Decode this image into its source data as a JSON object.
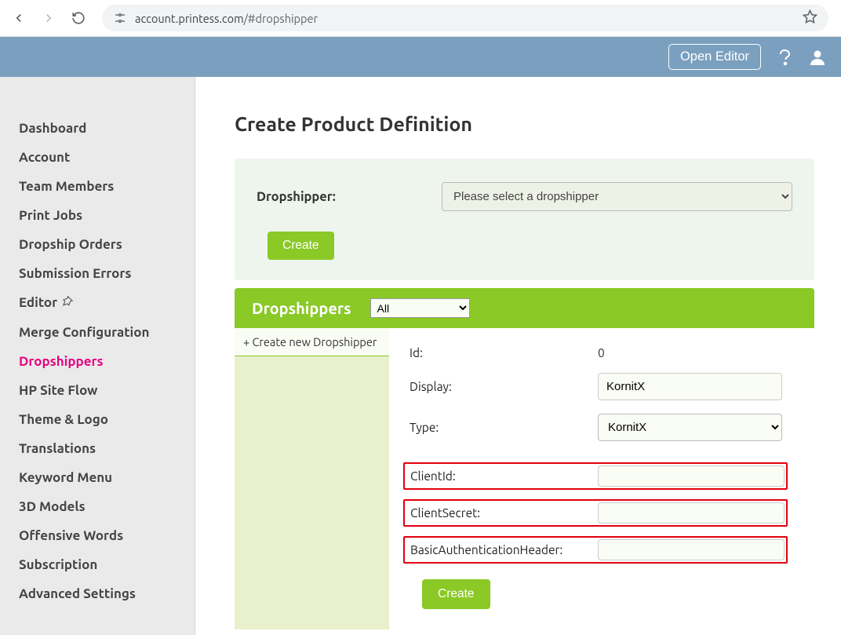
{
  "browser": {
    "url_host": "account.printess.com",
    "url_path": "/#dropshipper"
  },
  "app_bar": {
    "open_editor": "Open Editor"
  },
  "sidebar": {
    "items": [
      {
        "label": "Dashboard",
        "active": false
      },
      {
        "label": "Account",
        "active": false
      },
      {
        "label": "Team Members",
        "active": false
      },
      {
        "label": "Print Jobs",
        "active": false
      },
      {
        "label": "Dropship Orders",
        "active": false
      },
      {
        "label": "Submission Errors",
        "active": false
      },
      {
        "label": "Editor",
        "active": false,
        "icon": true
      },
      {
        "label": "Merge Configuration",
        "active": false
      },
      {
        "label": "Dropshippers",
        "active": true
      },
      {
        "label": "HP Site Flow",
        "active": false
      },
      {
        "label": "Theme & Logo",
        "active": false
      },
      {
        "label": "Translations",
        "active": false
      },
      {
        "label": "Keyword Menu",
        "active": false
      },
      {
        "label": "3D Models",
        "active": false
      },
      {
        "label": "Offensive Words",
        "active": false
      },
      {
        "label": "Subscription",
        "active": false
      },
      {
        "label": "Advanced Settings",
        "active": false
      }
    ]
  },
  "main": {
    "title": "Create Product Definition",
    "dropshipper_label": "Dropshipper:",
    "dropshipper_placeholder": "Please select a dropshipper",
    "create": "Create"
  },
  "ds": {
    "header": "Dropshippers",
    "filter": "All",
    "create_new": "+ Create new Dropshipper",
    "fields": {
      "id_label": "Id:",
      "id_value": "0",
      "display_label": "Display:",
      "display_value": "KornitX",
      "type_label": "Type:",
      "type_value": "KornitX",
      "clientid_label": "ClientId:",
      "clientsecret_label": "ClientSecret:",
      "basicauth_label": "BasicAuthenticationHeader:"
    },
    "create": "Create"
  }
}
